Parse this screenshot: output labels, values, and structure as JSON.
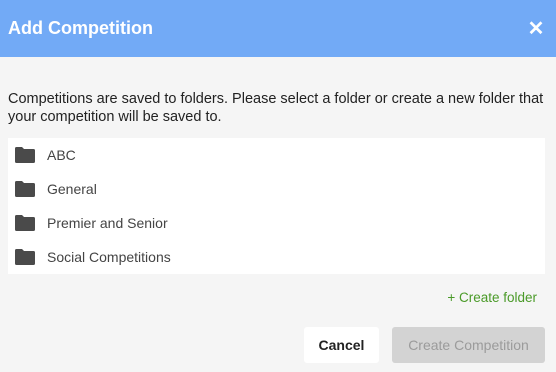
{
  "dialog": {
    "title": "Add Competition",
    "close_icon": "close-icon",
    "intro": "Competitions are saved to folders. Please select a folder or create a new folder that your competition will be saved to.",
    "folders": [
      {
        "label": "ABC",
        "icon": "folder-icon"
      },
      {
        "label": "General",
        "icon": "folder-icon"
      },
      {
        "label": "Premier and Senior",
        "icon": "folder-icon"
      },
      {
        "label": "Social Competitions",
        "icon": "folder-icon"
      }
    ],
    "create_folder_label": "+ Create folder",
    "cancel_label": "Cancel",
    "create_competition_label": "Create Competition",
    "colors": {
      "header": "#72aaf6",
      "create_folder_link": "#4a9a28",
      "disabled_button": "#d3d3d3"
    }
  }
}
